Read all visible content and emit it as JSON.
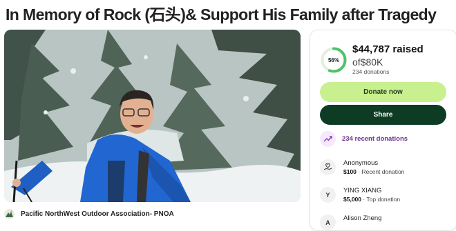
{
  "page": {
    "title": "In Memory of Rock (石头)& Support His Family after Tragedy"
  },
  "organizer": {
    "name": "Pacific NorthWest Outdoor Association- PNOA"
  },
  "progress": {
    "percent_label": "56%",
    "percent_value": 0.56,
    "raised_amount": "$44,787",
    "raised_word": "raised",
    "goal_prefix": "of",
    "goal": "$80K",
    "donations_count": "234 donations"
  },
  "buttons": {
    "donate": "Donate now",
    "share": "Share"
  },
  "recent": {
    "label": "234 recent donations"
  },
  "donations": [
    {
      "name": "Anonymous",
      "amount": "$100",
      "note": "· Recent donation",
      "icon": "heart-hand-icon",
      "initial": ""
    },
    {
      "name": "YING XIANG",
      "amount": "$5,000",
      "note": "· Top donation",
      "icon": "avatar",
      "initial": "Y"
    },
    {
      "name": "Alison Zheng",
      "amount": "",
      "note": "",
      "icon": "avatar",
      "initial": "A"
    }
  ],
  "colors": {
    "donate_button": "#c8f08f",
    "share_button": "#0d3b24",
    "progress_ring": "#4cc26a",
    "recent_accent": "#6b2f8f"
  }
}
